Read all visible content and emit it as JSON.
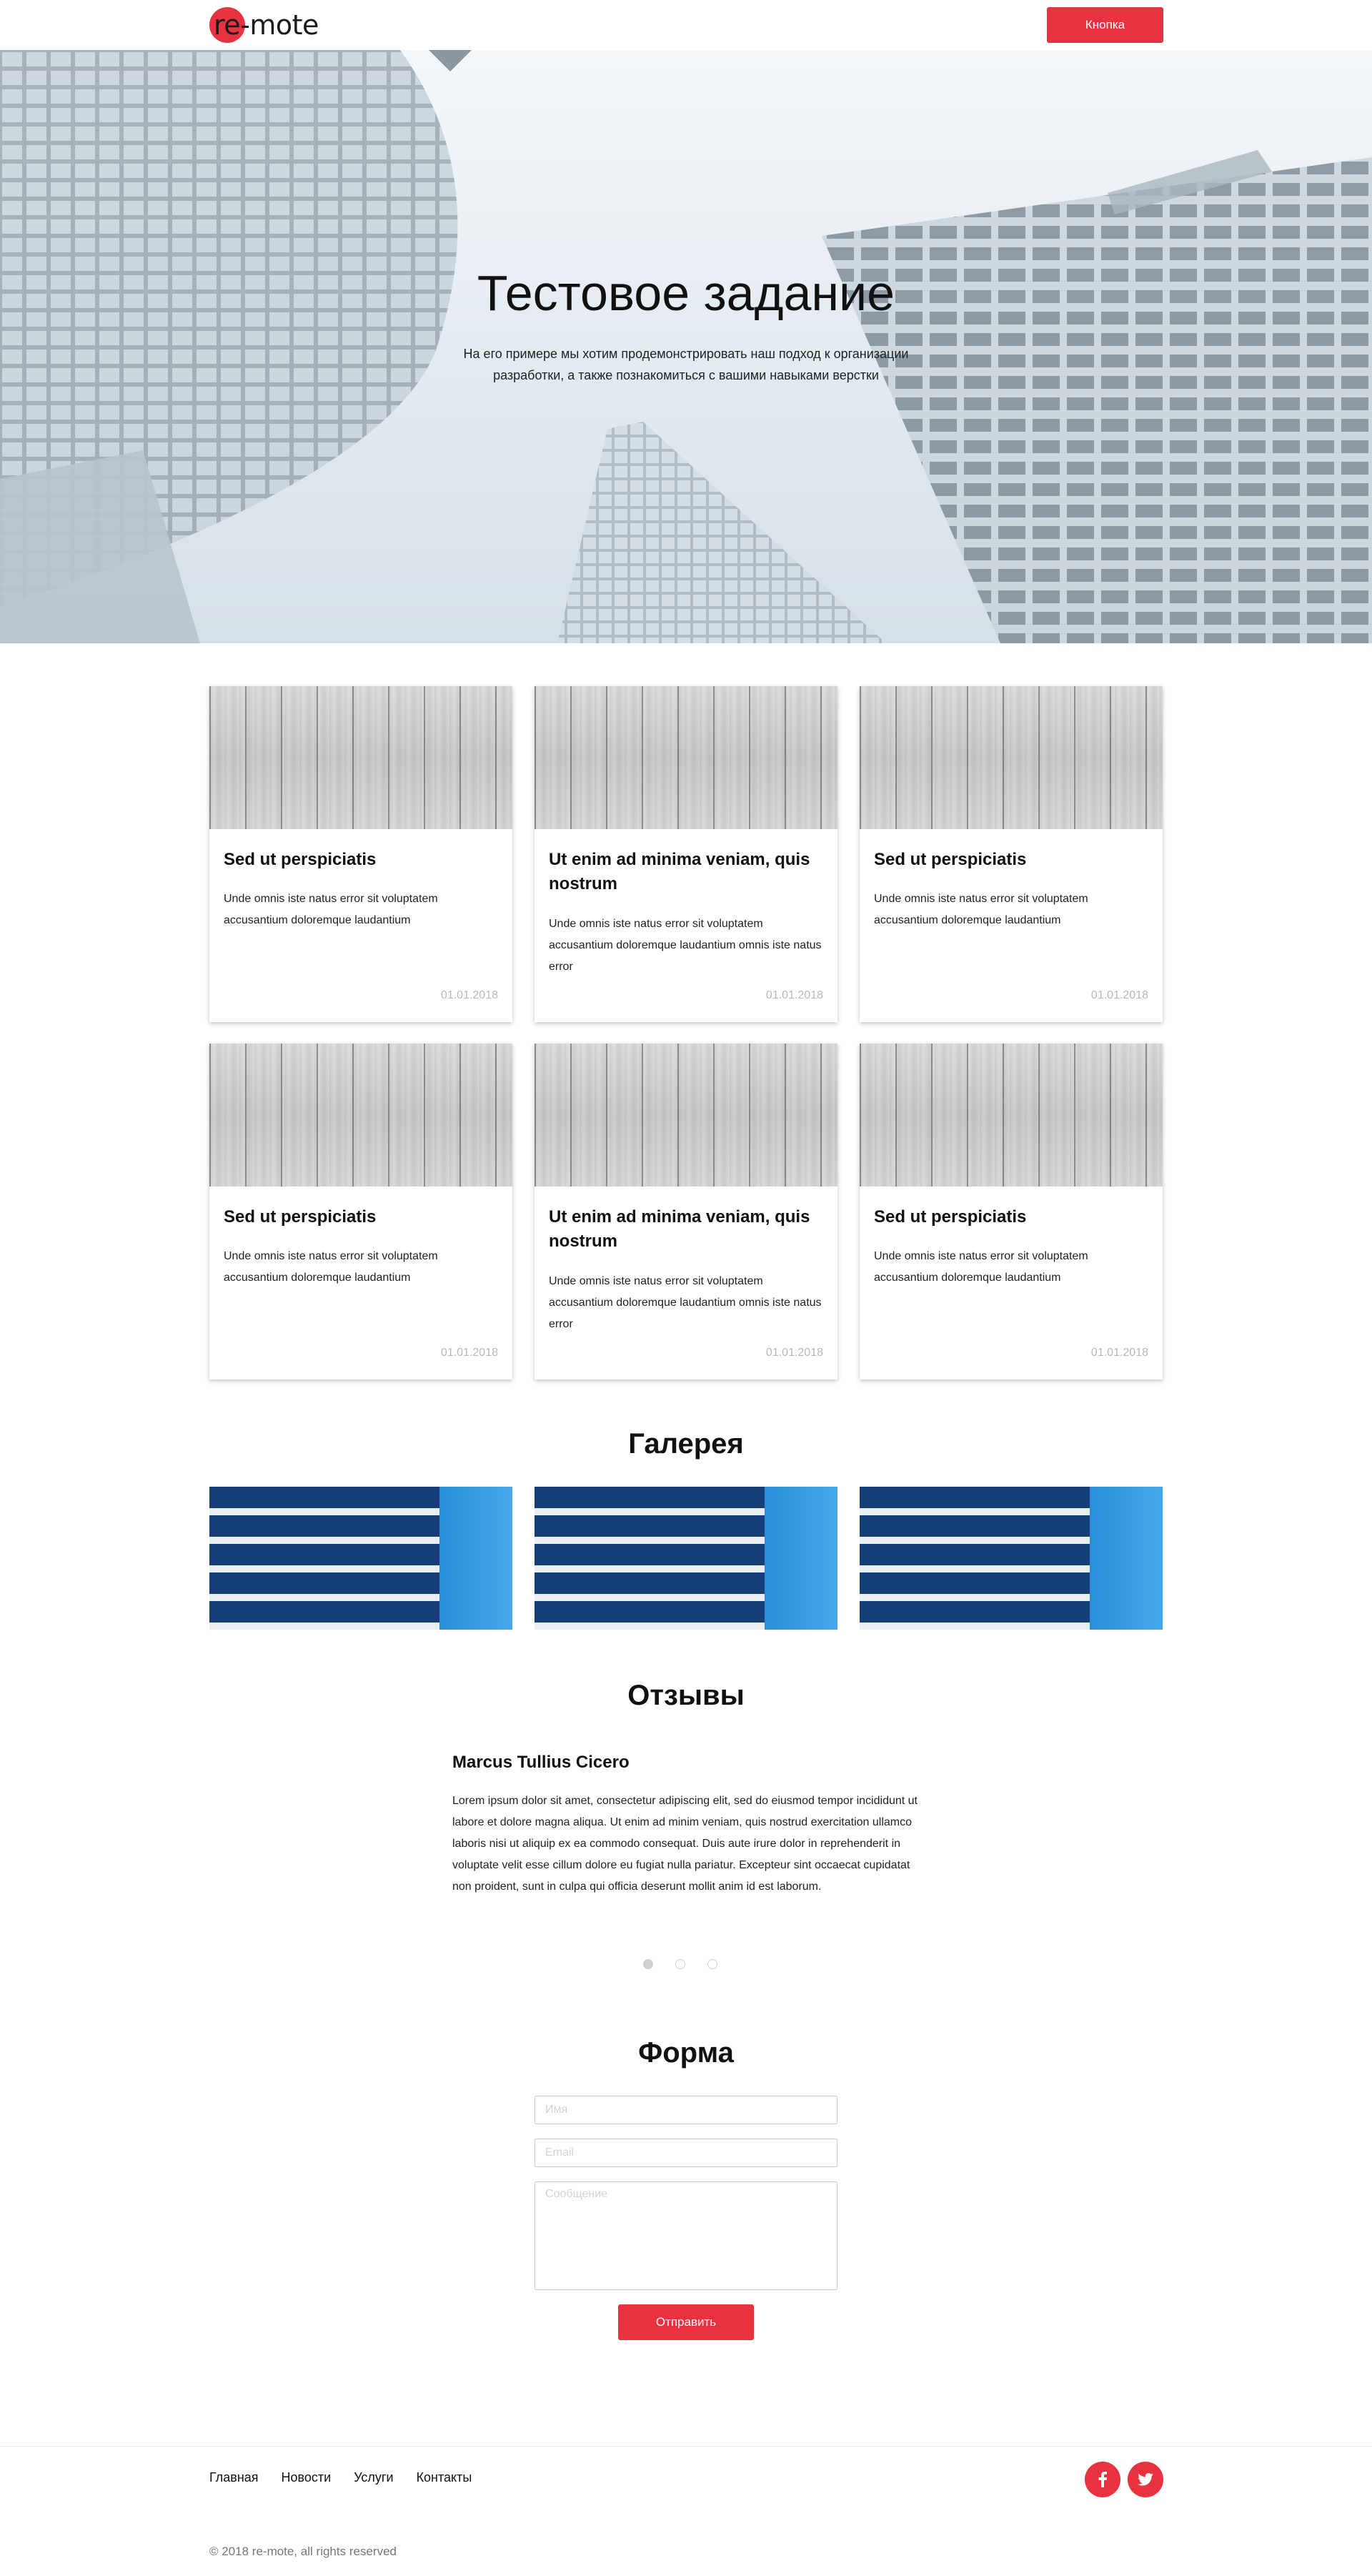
{
  "header": {
    "logo_text": "re-mote",
    "button_label": "Кнопка"
  },
  "hero": {
    "title": "Тестовое задание",
    "text": "На его примере мы хотим продемонстрировать наш подход к организации разработки, а также познакомиться с вашими навыками верстки"
  },
  "cards": [
    {
      "title": "Sed ut perspiciatis",
      "text": "Unde omnis iste natus error sit voluptatem accusantium doloremque laudantium",
      "date": "01.01.2018"
    },
    {
      "title": "Ut enim ad minima veniam, quis nostrum",
      "text": "Unde omnis iste natus error sit voluptatem accusantium doloremque laudantium omnis iste natus error",
      "date": "01.01.2018"
    },
    {
      "title": "Sed ut perspiciatis",
      "text": "Unde omnis iste natus error sit voluptatem accusantium doloremque laudantium",
      "date": "01.01.2018"
    },
    {
      "title": "Sed ut perspiciatis",
      "text": "Unde omnis iste natus error sit voluptatem accusantium doloremque laudantium",
      "date": "01.01.2018"
    },
    {
      "title": "Ut enim ad minima veniam, quis nostrum",
      "text": "Unde omnis iste natus error sit voluptatem accusantium doloremque laudantium omnis iste natus error",
      "date": "01.01.2018"
    },
    {
      "title": "Sed ut perspiciatis",
      "text": "Unde omnis iste natus error sit voluptatem accusantium doloremque laudantium",
      "date": "01.01.2018"
    }
  ],
  "gallery": {
    "title": "Галерея"
  },
  "reviews": {
    "title": "Отзывы",
    "name": "Marcus Tullius Cicero",
    "text": "Lorem ipsum dolor sit amet, consectetur adipiscing elit, sed do eiusmod tempor incididunt ut labore et dolore magna aliqua. Ut enim ad minim veniam, quis nostrud exercitation ullamco laboris nisi ut aliquip ex ea commodo consequat. Duis aute irure dolor in reprehenderit in voluptate velit esse cillum dolore eu fugiat nulla pariatur. Excepteur sint occaecat cupidatat non proident, sunt in culpa qui officia deserunt mollit anim id est laborum.",
    "active_slide": 1,
    "slide_count": 3
  },
  "form": {
    "title": "Форма",
    "name_placeholder": "Имя",
    "email_placeholder": "Email",
    "message_placeholder": "Сообщение",
    "submit_label": "Отправить"
  },
  "footer": {
    "nav": [
      "Главная",
      "Новости",
      "Услуги",
      "Контакты"
    ],
    "social": [
      {
        "icon": "facebook-icon",
        "glyph": "f"
      },
      {
        "icon": "twitter-icon",
        "glyph": "t"
      }
    ],
    "copyright": "© 2018 re-mote, all rights reserved"
  },
  "colors": {
    "accent": "#e8323f"
  }
}
